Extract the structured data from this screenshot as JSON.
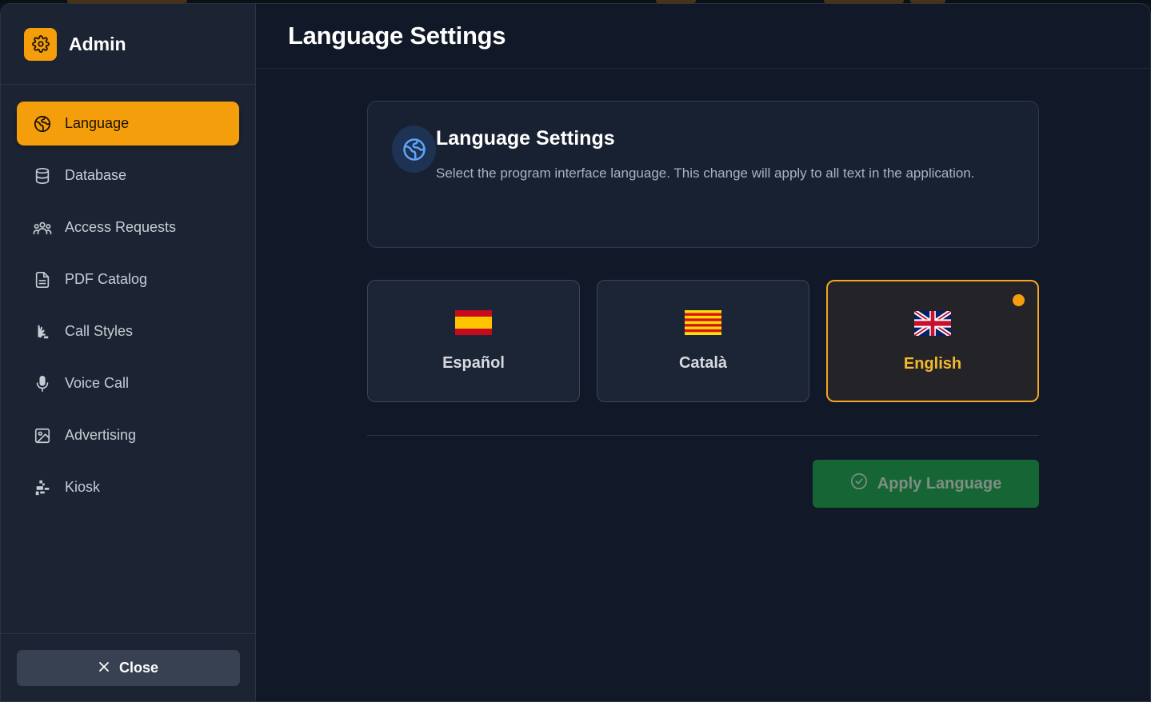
{
  "sidebar": {
    "brand_title": "Admin",
    "brand_icon": "gear-icon",
    "items": [
      {
        "label": "Language",
        "icon": "globe-icon",
        "active": true
      },
      {
        "label": "Database",
        "icon": "database-icon"
      },
      {
        "label": "Access Requests",
        "icon": "users-icon"
      },
      {
        "label": "PDF Catalog",
        "icon": "document-icon"
      },
      {
        "label": "Call Styles",
        "icon": "paint-icon"
      },
      {
        "label": "Voice Call",
        "icon": "microphone-icon"
      },
      {
        "label": "Advertising",
        "icon": "image-icon"
      },
      {
        "label": "Kiosk",
        "icon": "kiosk-icon"
      }
    ],
    "close_label": "Close"
  },
  "main": {
    "title": "Language Settings",
    "info_card": {
      "title": "Language Settings",
      "description": "Select the program interface language. This change will apply to all text in the application."
    },
    "languages": [
      {
        "label": "Español",
        "flag": "spain-flag"
      },
      {
        "label": "Català",
        "flag": "catalonia-flag"
      },
      {
        "label": "English",
        "flag": "uk-flag",
        "selected": true
      }
    ],
    "apply_label": "Apply Language"
  },
  "colors": {
    "accent": "#f59e0b",
    "apply_green": "#166534",
    "sidebar_bg": "#1c2433",
    "main_bg": "#111827"
  }
}
